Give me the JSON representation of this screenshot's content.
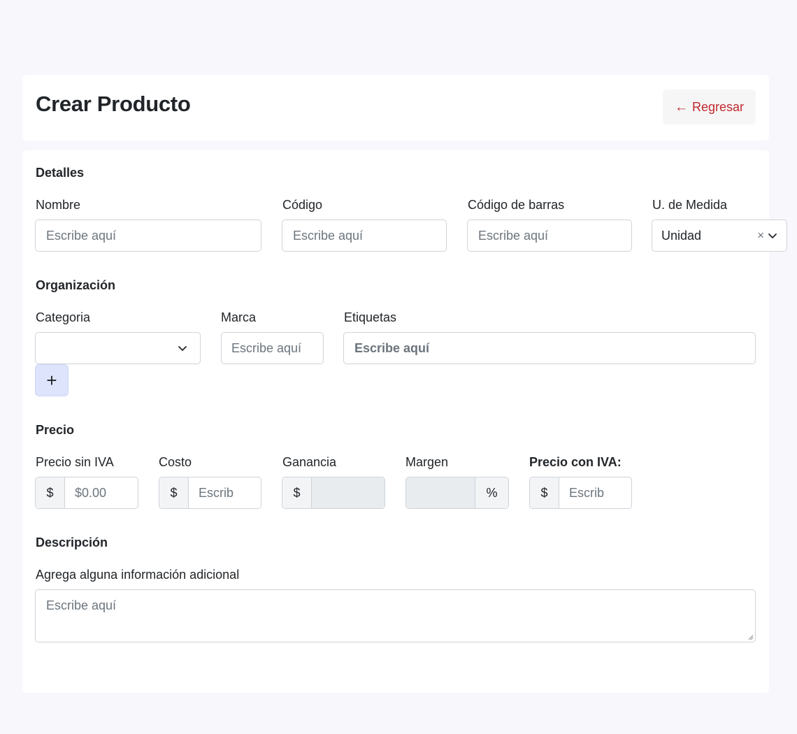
{
  "header": {
    "title": "Crear Producto",
    "back_label": "Regresar",
    "back_icon": "arrow-left-icon",
    "back_color": "#c0282e"
  },
  "details": {
    "section_title": "Detalles",
    "nombre": {
      "label": "Nombre",
      "placeholder": "Escribe aquí"
    },
    "codigo": {
      "label": "Código",
      "placeholder": "Escribe aquí"
    },
    "codigo_barras": {
      "label": "Código de barras",
      "placeholder": "Escribe aquí"
    },
    "unidad": {
      "label": "U. de Medida",
      "value": "Unidad",
      "clear_symbol": "×"
    }
  },
  "organization": {
    "section_title": "Organización",
    "categoria": {
      "label": "Categoria",
      "value": ""
    },
    "marca": {
      "label": "Marca",
      "placeholder": "Escribe aquí"
    },
    "etiquetas": {
      "label": "Etiquetas",
      "placeholder": "Escribe aquí"
    },
    "add_symbol": "+"
  },
  "price": {
    "section_title": "Precio",
    "precio_sin_iva": {
      "label": "Precio sin IVA",
      "prefix": "$",
      "placeholder": "$0.00"
    },
    "costo": {
      "label": "Costo",
      "prefix": "$",
      "placeholder": "Escrib"
    },
    "ganancia": {
      "label": "Ganancia",
      "prefix": "$",
      "value": ""
    },
    "margen": {
      "label": "Margen",
      "suffix": "%",
      "value": ""
    },
    "precio_con_iva": {
      "label": "Precio con IVA:",
      "prefix": "$",
      "placeholder": "Escrib"
    }
  },
  "description": {
    "section_title": "Descripción",
    "label": "Agrega alguna información adicional",
    "placeholder": "Escribe aquí"
  }
}
